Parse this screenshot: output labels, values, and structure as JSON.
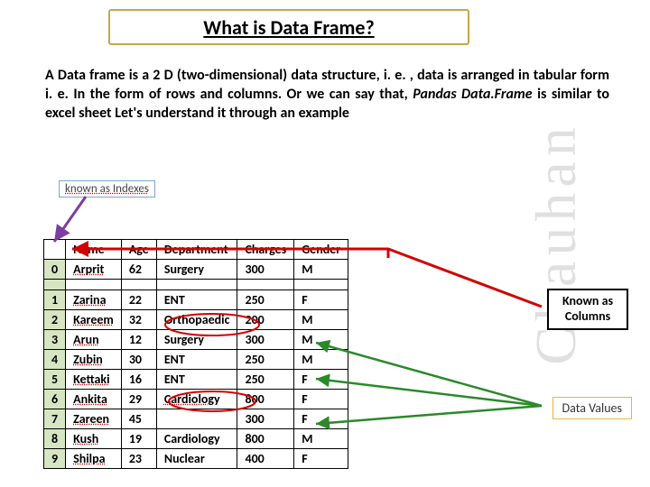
{
  "title": "What is Data Frame?",
  "description_parts": {
    "p1": "A Data frame is a 2 D (two-dimensional) data structure, i. e. , data is arranged in tabular form i. e.  In the form of  rows and columns. Or we can say that, ",
    "p2": "Pandas  Data.Frame ",
    "p3": "is similar to excel sheet Let's understand it through an example"
  },
  "labels": {
    "indexes": "known as Indexes",
    "columns": "Known as Columns",
    "values": "Data Values"
  },
  "watermark": "Chauhan",
  "table": {
    "headers": [
      "Name",
      "Age",
      "Department",
      "Charges",
      "Gender"
    ],
    "rows": [
      {
        "idx": "0",
        "cells": [
          "Arprit",
          "62",
          "Surgery",
          "300",
          "M"
        ]
      },
      {
        "idx": "1",
        "cells": [
          "Zarina",
          "22",
          "ENT",
          "250",
          "F"
        ]
      },
      {
        "idx": "2",
        "cells": [
          "Kareem",
          "32",
          "Orthopaedic",
          "200",
          "M"
        ]
      },
      {
        "idx": "3",
        "cells": [
          "Arun",
          "12",
          "Surgery",
          "300",
          "M"
        ]
      },
      {
        "idx": "4",
        "cells": [
          "Zubin",
          "30",
          "ENT",
          "250",
          "M"
        ]
      },
      {
        "idx": "5",
        "cells": [
          "Kettaki",
          "16",
          "ENT",
          "250",
          "F"
        ]
      },
      {
        "idx": "6",
        "cells": [
          "Ankita",
          "29",
          "Cardiology",
          "800",
          "F"
        ]
      },
      {
        "idx": "7",
        "cells": [
          "Zareen",
          "45",
          "",
          "300",
          "F"
        ]
      },
      {
        "idx": "8",
        "cells": [
          "Kush",
          "19",
          "Cardiology",
          "800",
          "M"
        ]
      },
      {
        "idx": "9",
        "cells": [
          "Shilpa",
          "23",
          "Nuclear",
          "400",
          "F"
        ]
      }
    ]
  }
}
